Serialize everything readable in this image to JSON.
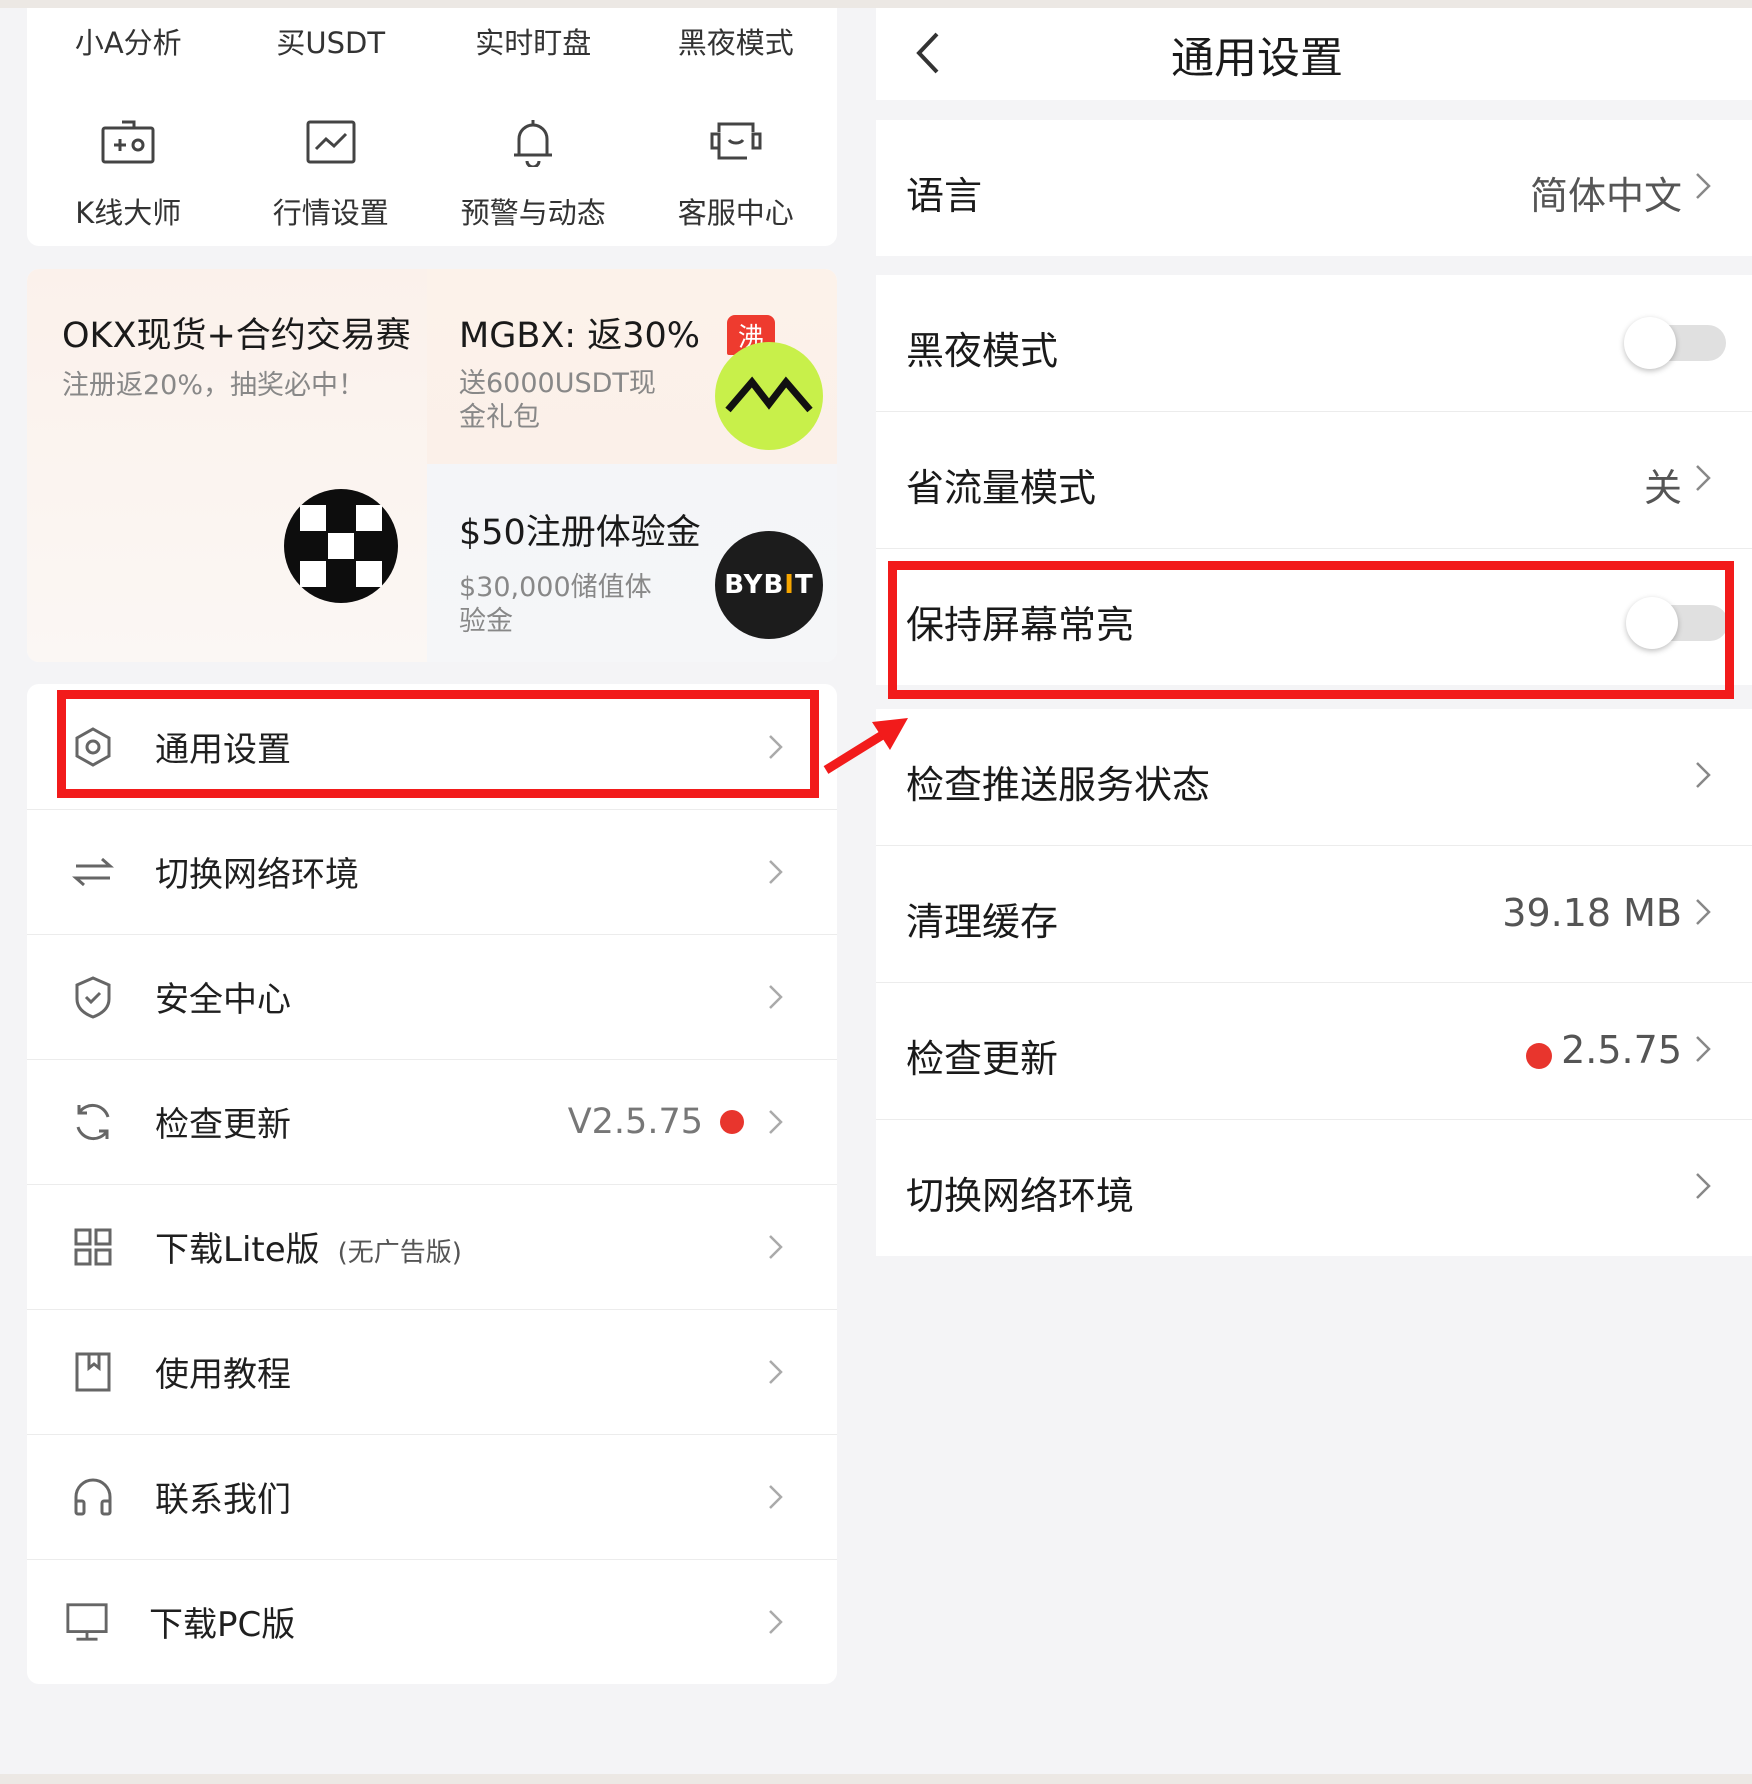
{
  "left": {
    "top_row": [
      "小A分析",
      "买USDT",
      "实时盯盘",
      "黑夜模式"
    ],
    "icon_row": [
      {
        "label": "K线大师",
        "icon": "chart-box-icon"
      },
      {
        "label": "行情设置",
        "icon": "trend-chart-icon"
      },
      {
        "label": "预警与动态",
        "icon": "bell-icon"
      },
      {
        "label": "客服中心",
        "icon": "customer-service-icon"
      }
    ],
    "ads": {
      "okx": {
        "title": "OKX现货+合约交易赛",
        "sub": "注册返20%，抽奖必中！"
      },
      "mgbx": {
        "title": "MGBX: 返30%",
        "badge": "沸",
        "sub": "送6000USDT现金礼包"
      },
      "bybit": {
        "title": "$50注册体验金",
        "sub": "$30,000储值体验金",
        "logo_text": "BYBIT"
      }
    },
    "menu": [
      {
        "label": "通用设置",
        "icon": "settings-hexagon-icon"
      },
      {
        "label": "切换网络环境",
        "icon": "switch-arrows-icon"
      },
      {
        "label": "安全中心",
        "icon": "shield-check-icon"
      },
      {
        "label": "检查更新",
        "icon": "refresh-icon",
        "value": "V2.5.75",
        "dot": true
      },
      {
        "label": "下载Lite版",
        "sub": "(无广告版)",
        "icon": "grid-apps-icon"
      },
      {
        "label": "使用教程",
        "icon": "book-icon"
      },
      {
        "label": "联系我们",
        "icon": "headphones-icon"
      },
      {
        "label": "下载PC版",
        "icon": "monitor-icon"
      }
    ]
  },
  "right": {
    "title": "通用设置",
    "rows": [
      {
        "label": "语言",
        "value": "简体中文",
        "type": "nav"
      },
      {
        "label": "黑夜模式",
        "type": "toggle",
        "on": false
      },
      {
        "label": "省流量模式",
        "value": "关",
        "type": "nav"
      },
      {
        "label": "保持屏幕常亮",
        "type": "toggle",
        "on": false
      },
      {
        "label": "检查推送服务状态",
        "type": "nav"
      },
      {
        "label": "清理缓存",
        "value": "39.18 MB",
        "type": "nav"
      },
      {
        "label": "检查更新",
        "value": "2.5.75",
        "type": "nav",
        "dot": true
      },
      {
        "label": "切换网络环境",
        "type": "nav"
      }
    ]
  },
  "colors": {
    "highlight": "#f21b1b",
    "dot": "#e8352d",
    "mgbx_bg": "#c8f04a",
    "badge": "#ee3b2f"
  }
}
